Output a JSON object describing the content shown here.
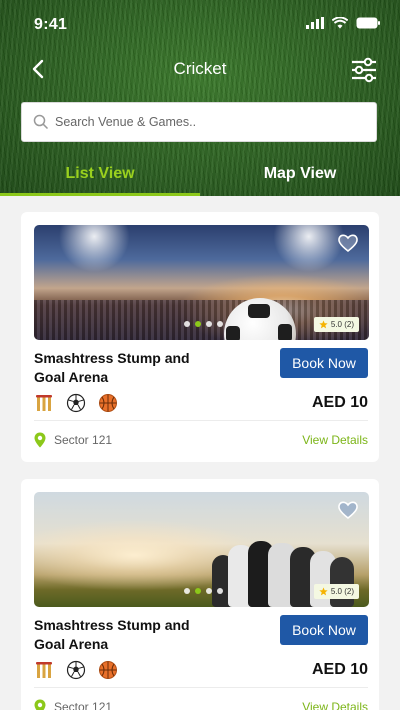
{
  "status": {
    "time": "9:41"
  },
  "nav": {
    "title": "Cricket"
  },
  "search": {
    "placeholder": "Search Venue & Games.."
  },
  "tabs": [
    {
      "label": "List View",
      "active": true
    },
    {
      "label": "Map View",
      "active": false
    }
  ],
  "colors": {
    "accent": "#8cc81a",
    "button": "#1f58a6",
    "link": "#7cb518"
  },
  "venues": [
    {
      "name": "Smashtress Stump and Goal Arena",
      "rating": "5.0 (2)",
      "book_label": "Book Now",
      "price": "AED 10",
      "location": "Sector 121",
      "details_label": "View Details",
      "sports": [
        "cricket-icon",
        "football-icon",
        "basketball-icon"
      ]
    },
    {
      "name": "Smashtress Stump and Goal Arena",
      "rating": "5.0 (2)",
      "book_label": "Book Now",
      "price": "AED 10",
      "location": "Sector 121",
      "details_label": "View Details",
      "sports": [
        "cricket-icon",
        "football-icon",
        "basketball-icon"
      ]
    }
  ]
}
